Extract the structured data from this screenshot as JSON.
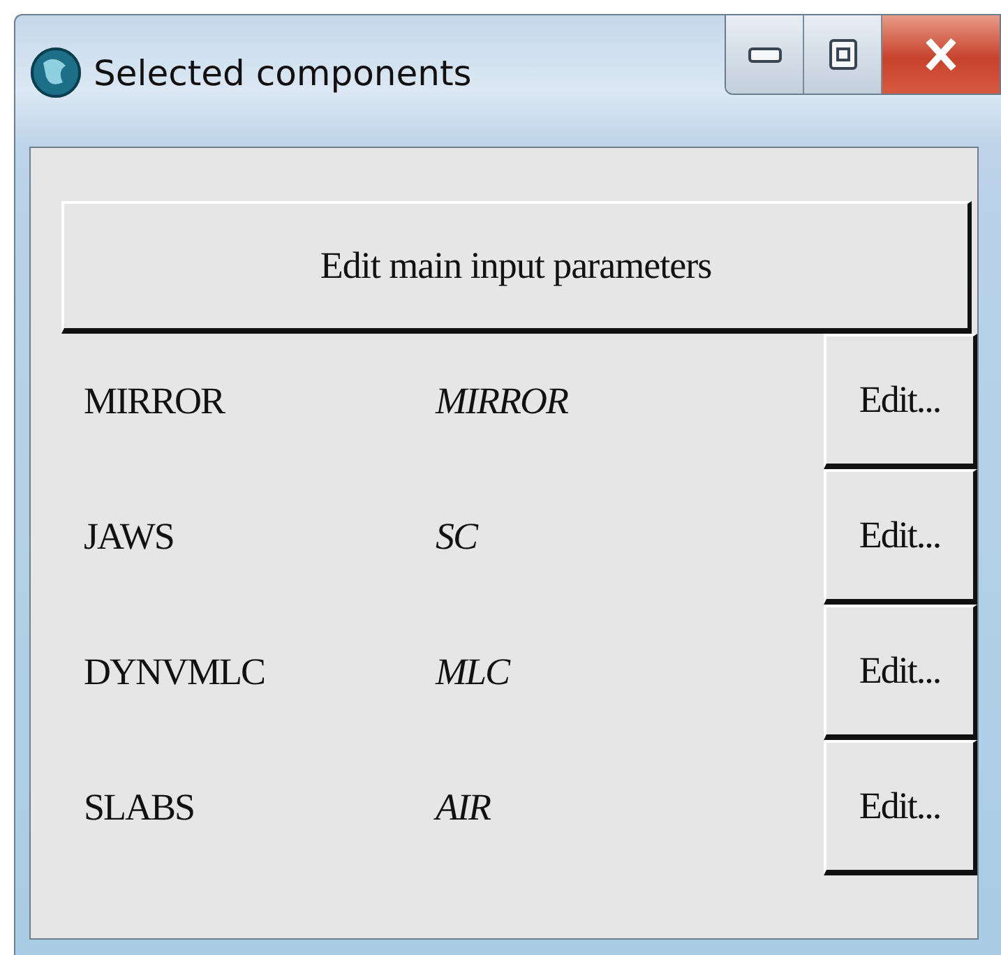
{
  "window": {
    "title": "Selected components"
  },
  "main_button": "Edit main input parameters",
  "components": [
    {
      "name": "MIRROR",
      "type": "MIRROR",
      "button": "Edit..."
    },
    {
      "name": "JAWS",
      "type": "SC",
      "button": "Edit..."
    },
    {
      "name": "DYNVMLC",
      "type": "MLC",
      "button": "Edit..."
    },
    {
      "name": "SLABS",
      "type": "AIR",
      "button": "Edit..."
    }
  ]
}
